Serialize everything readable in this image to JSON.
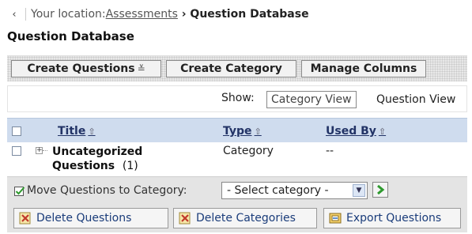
{
  "breadcrumb": {
    "prefix": "Your location: ",
    "link": "Assessments",
    "separator": " › ",
    "current": "Question Database"
  },
  "page_title": "Question Database",
  "toolbar": {
    "create_questions": "Create Questions",
    "create_category": "Create Category",
    "manage_columns": "Manage Columns"
  },
  "view": {
    "show_label": "Show:",
    "category_view": "Category View",
    "question_view": "Question View"
  },
  "table": {
    "columns": {
      "title": "Title",
      "type": "Type",
      "used_by": "Used By"
    },
    "rows": [
      {
        "title_line1": "Uncategorized",
        "title_line2": "Questions",
        "count": "(1)",
        "type": "Category",
        "used_by": "--"
      }
    ]
  },
  "footer": {
    "move_label": "Move Questions to Category:",
    "select_value": "- Select category -",
    "delete_questions": "Delete Questions",
    "delete_categories": "Delete Categories",
    "export_questions": "Export Questions"
  },
  "colors": {
    "header_bg": "#cfdcee",
    "link": "#223366",
    "action_text": "#1a3c7a",
    "go_arrow": "#2e9a2e"
  }
}
